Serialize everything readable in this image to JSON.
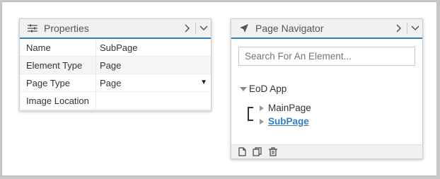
{
  "properties_panel": {
    "title": "Properties",
    "icon": "sliders-icon",
    "rows": [
      {
        "key": "Name",
        "value": "SubPage"
      },
      {
        "key": "Element Type",
        "value": "Page"
      },
      {
        "key": "Page Type",
        "value": "Page",
        "dropdown": true
      },
      {
        "key": "Image Location",
        "value": ""
      }
    ]
  },
  "navigator_panel": {
    "title": "Page Navigator",
    "icon": "navigation-arrow-icon",
    "search_placeholder": "Search For An Element...",
    "tree": {
      "root": "EoD App",
      "children": [
        {
          "label": "MainPage",
          "selected": false
        },
        {
          "label": "SubPage",
          "selected": true
        }
      ]
    },
    "footer_icons": [
      "new-page-icon",
      "copy-page-icon",
      "delete-icon"
    ]
  },
  "colors": {
    "accent": "#2f7fc1",
    "header_bg": "#f1f1f1",
    "outer_bg": "#c8c8c8"
  }
}
